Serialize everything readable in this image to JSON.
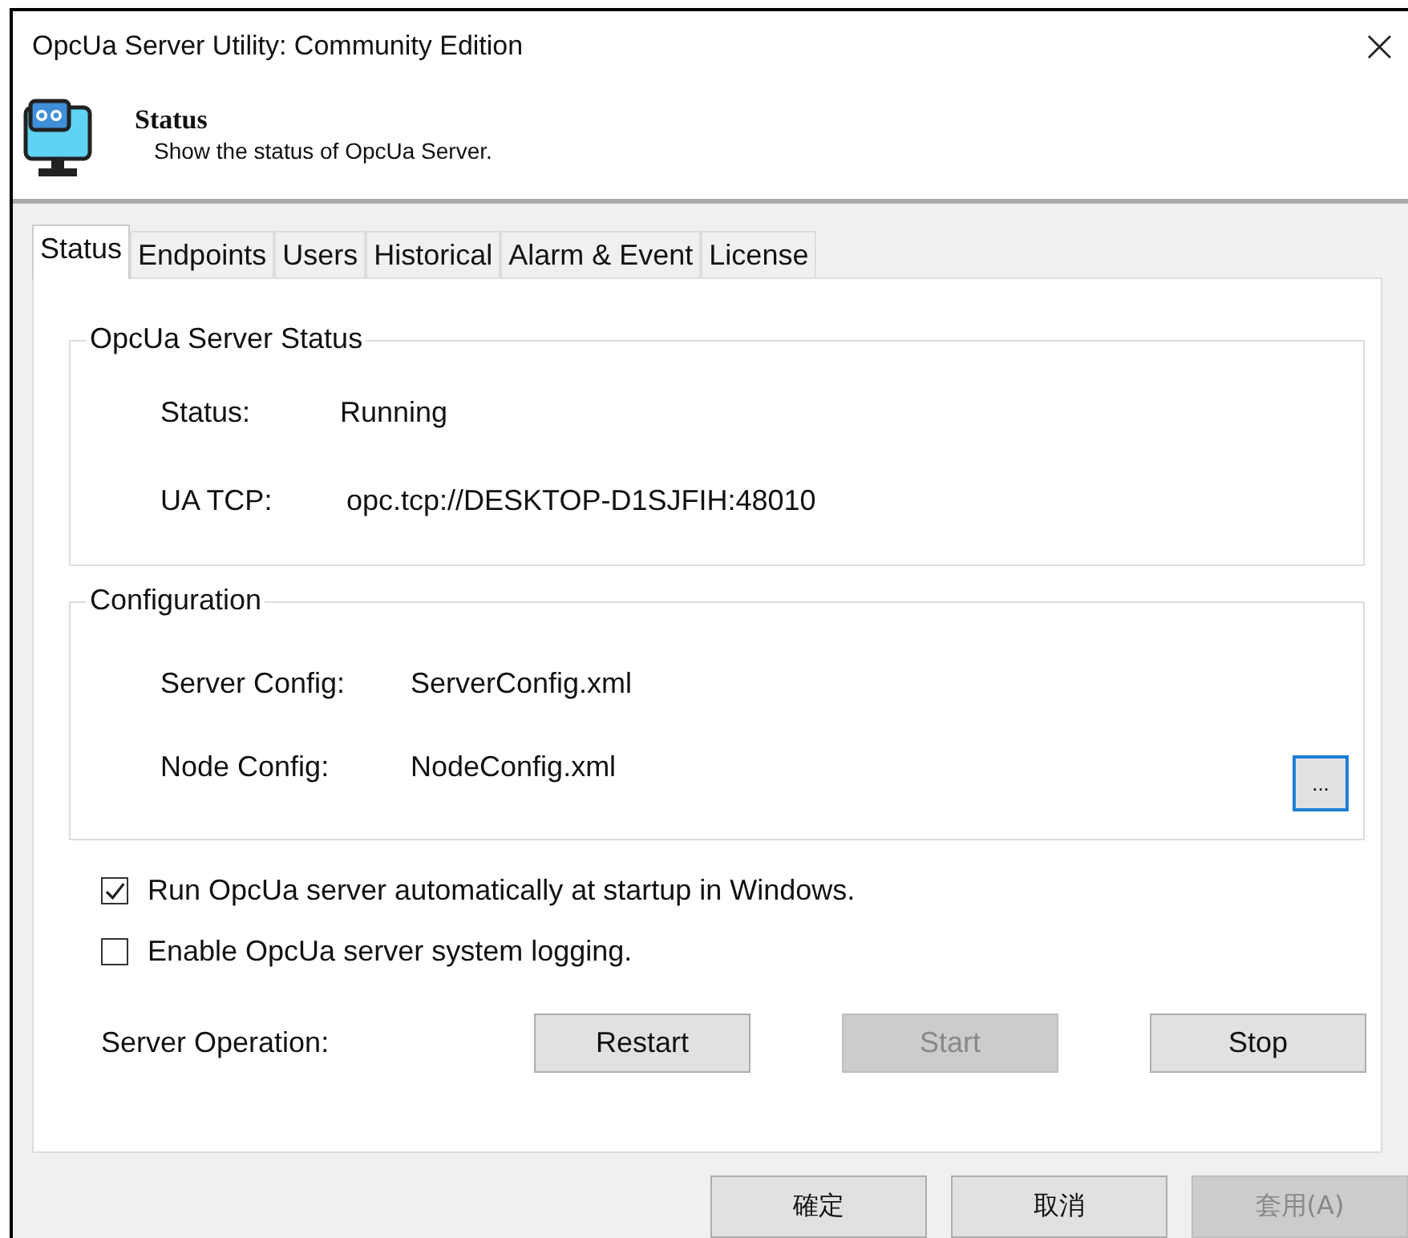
{
  "window": {
    "title": "OpcUa Server Utility: Community Edition",
    "close": "×"
  },
  "header": {
    "title": "Status",
    "subtitle": "Show the status of OpcUa Server."
  },
  "tabs": [
    {
      "label": "Status",
      "selected": true
    },
    {
      "label": "Endpoints",
      "selected": false
    },
    {
      "label": "Users",
      "selected": false
    },
    {
      "label": "Historical",
      "selected": false
    },
    {
      "label": "Alarm & Event",
      "selected": false
    },
    {
      "label": "License",
      "selected": false
    }
  ],
  "groups": [
    {
      "title": "OpcUa Server Status",
      "fields": [
        {
          "label": "Status:",
          "value": "Running"
        },
        {
          "label": "UA TCP:",
          "value": "opc.tcp://DESKTOP-D1SJFIH:48010"
        }
      ]
    },
    {
      "title": "Configuration",
      "fields": [
        {
          "label": "Server Config:",
          "value": "ServerConfig.xml"
        },
        {
          "label": "Node Config:",
          "value": "NodeConfig.xml"
        }
      ],
      "browse_button": "..."
    }
  ],
  "checkboxes": [
    {
      "label": "Run OpcUa server automatically at startup in Windows.",
      "checked": true
    },
    {
      "label": "Enable OpcUa server system logging.",
      "checked": false
    }
  ],
  "server_operation": {
    "label": "Server Operation:",
    "buttons": [
      {
        "label": "Restart",
        "disabled": false
      },
      {
        "label": "Start",
        "disabled": true
      },
      {
        "label": "Stop",
        "disabled": false
      }
    ]
  },
  "dialog_buttons": [
    {
      "label": "確定",
      "disabled": false
    },
    {
      "label": "取消",
      "disabled": false
    },
    {
      "label": "套用(A)",
      "disabled": true
    }
  ]
}
